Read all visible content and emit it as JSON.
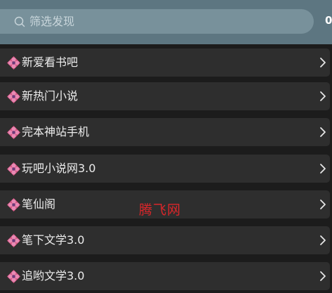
{
  "header": {
    "search": {
      "placeholder": "筛选发现",
      "icon": "search-icon"
    },
    "edge_text": "0"
  },
  "list": {
    "item_icon": "flower-icon",
    "item_icon_color": "#d2527f",
    "items": [
      {
        "label": "新爱看书吧"
      },
      {
        "label": "新热门小说"
      },
      {
        "label": "完本神站手机"
      },
      {
        "label": "玩吧小说网3.0"
      },
      {
        "label": "笔仙阁"
      },
      {
        "label": "笔下文学3.0"
      },
      {
        "label": "追哟文学3.0"
      }
    ]
  },
  "watermark": "腾飞网",
  "colors": {
    "header_bg": "#5d7681",
    "search_bg": "#78919b",
    "row_bg": "#2e2e2e",
    "page_bg": "#1c1c1c",
    "watermark": "#d9262a"
  }
}
